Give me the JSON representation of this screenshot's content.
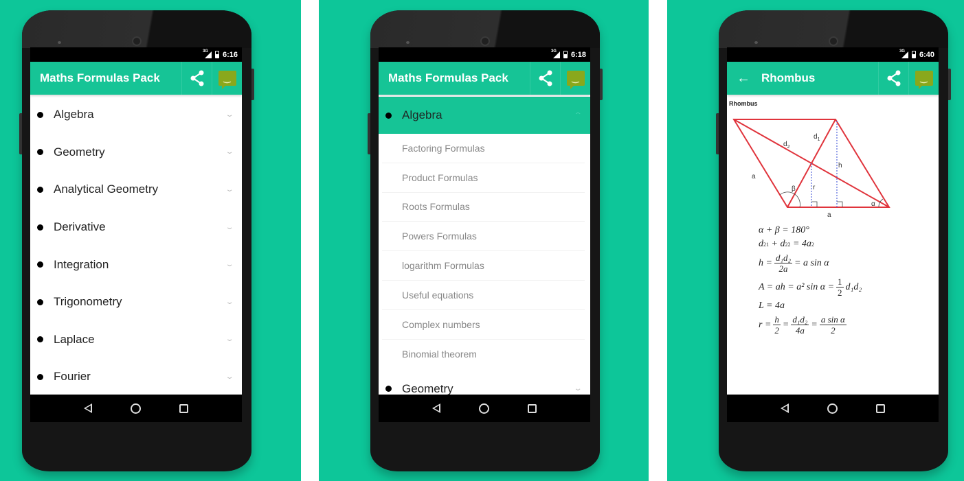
{
  "colors": {
    "background": "#0dc699",
    "appbar": "#16c496",
    "phone": "#161616"
  },
  "screens": [
    {
      "status_time": "6:16",
      "network": "3G",
      "app_title": "Maths Formulas Pack",
      "actions": {
        "share": "share-icon",
        "feedback": "smiley-message-icon"
      },
      "groups": [
        {
          "label": "Algebra"
        },
        {
          "label": "Geometry"
        },
        {
          "label": "Analytical Geometry"
        },
        {
          "label": "Derivative"
        },
        {
          "label": "Integration"
        },
        {
          "label": "Trigonometry"
        },
        {
          "label": "Laplace"
        },
        {
          "label": "Fourier"
        }
      ]
    },
    {
      "status_time": "6:18",
      "network": "3G",
      "app_title": "Maths Formulas Pack",
      "expanded_group": "Algebra",
      "children": [
        "Factoring Formulas",
        "Product Formulas",
        "Roots Formulas",
        "Powers Formulas",
        "logarithm Formulas",
        "Useful equations",
        "Complex numbers",
        "Binomial theorem"
      ],
      "next_group": "Geometry"
    },
    {
      "status_time": "6:40",
      "network": "3G",
      "app_title": "Rhombus",
      "back_icon": "←",
      "doc_heading": "Rhombus",
      "diagram_labels": {
        "side": "a",
        "d1": "d",
        "d1_sub": "1",
        "d2": "d",
        "d2_sub": "2",
        "height": "h",
        "radius": "r",
        "alpha": "α",
        "beta": "β"
      },
      "formulas": {
        "f1": "α + β = 180°",
        "f2_a": "d",
        "f2_b": "+ d",
        "f2_c": "= 4a",
        "f3_lhs": "h =",
        "f3_num": "d₁d₂",
        "f3_den": "2a",
        "f3_rhs": "= a sin α",
        "f4_lhs": "A = ah = a² sin α =",
        "f4_num": "1",
        "f4_den": "2",
        "f4_rhs": "d₁d₂",
        "f5": "L = 4a",
        "f6_lhs": "r =",
        "f6_n1": "h",
        "f6_d1": "2",
        "f6_eq": "=",
        "f6_n2": "d₁d₂",
        "f6_d2": "4a",
        "f6_eq2": "=",
        "f6_n3": "a sin α",
        "f6_d3": "2"
      }
    }
  ],
  "navbar": {
    "back": "back-nav-icon",
    "home": "home-nav-icon",
    "recents": "recents-nav-icon"
  },
  "icons": {
    "chevron_down": "⌄",
    "chevron_up": "⌃",
    "smiley": "ᵕ‿ᵕ"
  }
}
